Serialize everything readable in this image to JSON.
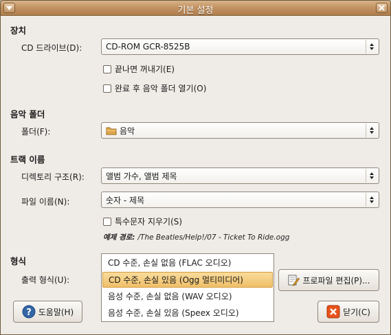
{
  "window": {
    "title": "기본 설정"
  },
  "sections": {
    "device": "장치",
    "music_folder": "음악 폴더",
    "track_name": "트랙 이름",
    "format": "형식"
  },
  "device": {
    "cd_drive_label": "CD 드라이브(D):",
    "cd_drive_value": "CD-ROM GCR-8525B",
    "eject_label": "끝나면 꺼내기(E)",
    "eject_checked": false,
    "open_folder_label": "완료 후 음악 폴더 열기(O)",
    "open_folder_checked": false
  },
  "music_folder": {
    "folder_label": "폴더(F):",
    "folder_value": "음악",
    "folder_icon": "folder-icon"
  },
  "track_name": {
    "dir_label": "디렉토리 구조(R):",
    "dir_value": "앨범 가수, 앨범 제목",
    "file_label": "파일 이름(N):",
    "file_value": "숫자 - 제목",
    "strip_label": "특수문자 지우기(S)",
    "strip_checked": false,
    "example_prefix": "예제 경로:",
    "example_path": "/The Beatles/Help!/07 - Ticket To Ride.ogg"
  },
  "format": {
    "output_label": "출력 형식(U):",
    "options": [
      "CD 수준, 손실 없음 (FLAC 오디오)",
      "CD 수준, 손실 있음 (Ogg 멀티미디어)",
      "음성 수준, 손실 없음 (WAV 오디오)",
      "음성 수준, 손실 있음 (Speex 오디오)"
    ],
    "selected_index": 1,
    "edit_profile_label": "프로파일 편집(P)..."
  },
  "buttons": {
    "help_label": "도움말(H)",
    "close_label": "닫기(C)"
  },
  "colors": {
    "titlebar": "#c49464",
    "window_bg": "#efebe7",
    "selection": "#f0bf68",
    "help_icon": "#3465a4",
    "close_icon": "#e8521a"
  }
}
